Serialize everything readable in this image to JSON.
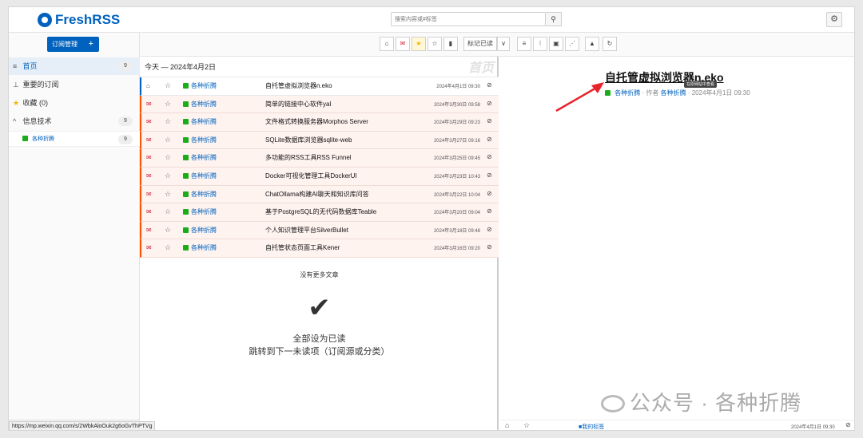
{
  "app": {
    "name": "FreshRSS"
  },
  "header": {
    "search_placeholder": "搜索内容或#标签"
  },
  "sidebar": {
    "subscription_button": "订阅管理",
    "items": [
      {
        "label": "首页",
        "count": "9"
      },
      {
        "label": "重要的订阅",
        "count": ""
      },
      {
        "label": "收藏 (0)",
        "count": ""
      },
      {
        "label": "信息技术",
        "count": "9"
      }
    ],
    "feed": {
      "label": "各种折腾",
      "count": "9"
    }
  },
  "status_url": "https://mp.weixin.qq.com/s/2WbkAloOuk2g6oGvThPTVg",
  "toolbar": {
    "mark_read_label": "标记已读"
  },
  "list": {
    "day_header": "今天 — 2024年4月2日",
    "watermark": "首页",
    "articles": [
      {
        "feed": "各种折腾",
        "title": "自托管虚拟浏览器n.eko",
        "date": "2024年4月1日 09:30",
        "read": true
      },
      {
        "feed": "各种折腾",
        "title": "简单的链接中心软件yal",
        "date": "2024年3月30日 09:58",
        "read": false
      },
      {
        "feed": "各种折腾",
        "title": "文件格式转换服务器Morphos Server",
        "date": "2024年3月29日 09:23",
        "read": false
      },
      {
        "feed": "各种折腾",
        "title": "SQLite数据库浏览器sqlite-web",
        "date": "2024年3月27日 09:16",
        "read": false
      },
      {
        "feed": "各种折腾",
        "title": "多功能的RSS工具RSS Funnel",
        "date": "2024年3月25日 09:45",
        "read": false
      },
      {
        "feed": "各种折腾",
        "title": "Docker可视化管理工具DockerUI",
        "date": "2024年3月23日 10:43",
        "read": false
      },
      {
        "feed": "各种折腾",
        "title": "ChatOllama构建AI聊天和知识库问答",
        "date": "2024年3月22日 10:04",
        "read": false
      },
      {
        "feed": "各种折腾",
        "title": "基于PostgreSQL的无代码数据库Teable",
        "date": "2024年3月20日 09:04",
        "read": false
      },
      {
        "feed": "各种折腾",
        "title": "个人知识管理平台SilverBullet",
        "date": "2024年3月18日 09:48",
        "read": false
      },
      {
        "feed": "各种折腾",
        "title": "自托管状态页面工具Kener",
        "date": "2024年3月16日 09:20",
        "read": false
      }
    ],
    "no_more": "没有更多文章",
    "mark_all_read": "全部设为已读",
    "jump_next": "跳转到下一未读项（订阅源或分类）"
  },
  "reader": {
    "title": "自托管虚拟浏览器n.eko",
    "tooltip": "在原网站中查看",
    "feed": "各种折腾",
    "author_label": "作者",
    "author": "各种折腾",
    "date": "2024年4月1日 09:30",
    "tags_label": "我的标签",
    "footer_date": "2024年4月1日 09:30"
  },
  "watermark": "公众号 · 各种折腾",
  "colors": {
    "accent": "#0062be",
    "unread_bg": "#fff3f0",
    "unread_border": "#ff5300",
    "arrow": "#e8242a"
  }
}
